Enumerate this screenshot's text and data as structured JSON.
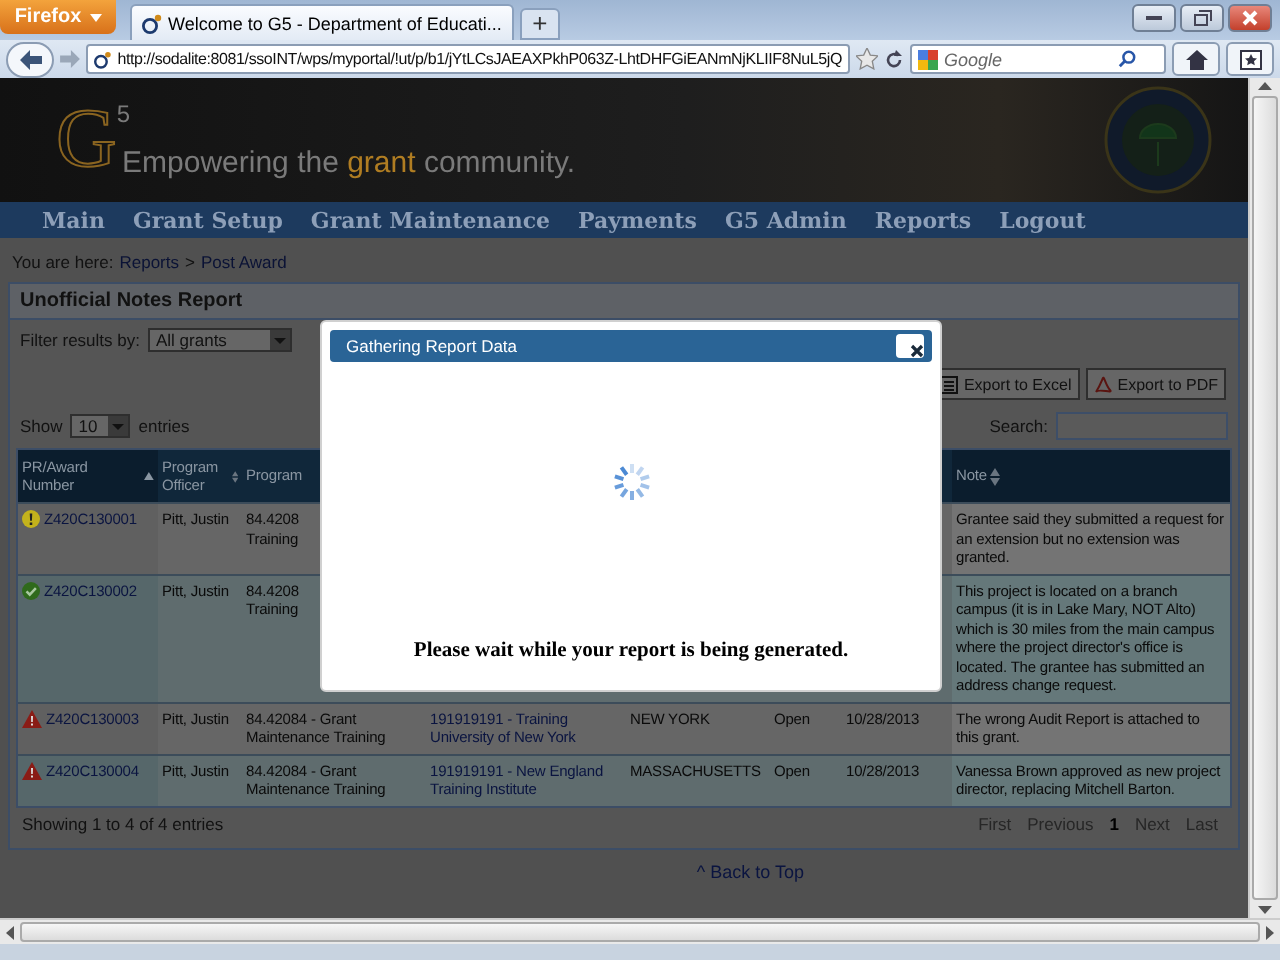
{
  "browser": {
    "menu_button": "Firefox",
    "tab_title": "Welcome to G5 - Department of Educati...",
    "new_tab": "+",
    "url": "http://sodalite:8081/ssoINT/wps/myportal/!ut/p/b1/jYtLCsJAEAXPkhP063Z-LhtDHFGiEANmNjKLIIF8NuL5jQ",
    "search_placeholder": "Google"
  },
  "banner": {
    "logo_letter": "G",
    "logo_sup": "5",
    "tagline": [
      {
        "text": "Empowering the ",
        "highlight": false
      },
      {
        "text": "grant",
        "highlight": true
      },
      {
        "text": " community.",
        "highlight": false
      }
    ]
  },
  "nav": [
    "Main",
    "Grant Setup",
    "Grant Maintenance",
    "Payments",
    "G5 Admin",
    "Reports",
    "Logout"
  ],
  "breadcrumb": {
    "label": "You are here:",
    "links": [
      "Reports",
      "Post Award"
    ],
    "separator": ">"
  },
  "panel": {
    "title": "Unofficial Notes Report",
    "filter_label": "Filter results by:",
    "filter_value": "All grants",
    "exports": [
      {
        "kind": "excel",
        "label": "Export to Excel"
      },
      {
        "kind": "pdf",
        "label": "Export to PDF"
      }
    ],
    "show_label": "Show",
    "show_value": "10",
    "entries_label": "entries",
    "search_label": "Search:"
  },
  "table": {
    "columns": [
      {
        "label": "PR/Award Number",
        "kind": "asc"
      },
      {
        "label": "Program Officer",
        "kind": "both"
      },
      {
        "label": "Program",
        "kind": "none"
      },
      {
        "label": "Note",
        "kind": "both"
      }
    ],
    "rows": [
      {
        "kind": "warning",
        "pr": "Z420C130001",
        "officer": "Pitt, Justin",
        "program": "84.4208\nTraining",
        "note": "Grantee said they submitted a request for an extension but no extension was granted."
      },
      {
        "kind": "ok",
        "pr": "Z420C130002",
        "officer": "Pitt, Justin",
        "program": "84.4208\nTraining",
        "note": "This project is located on a branch campus (it is in Lake Mary, NOT Alto) which is 30 miles from the main campus where the project director's office is located. The grantee has submitted an address change request."
      },
      {
        "kind": "error",
        "pr": "Z420C130003",
        "officer": "Pitt, Justin",
        "program": "84.42084 - Grant Maintenance Training",
        "grantee": "191919191 - Training University of New York",
        "state": "NEW YORK",
        "state_status": "Open",
        "date": "10/28/2013",
        "note": "The wrong Audit Report is attached to this grant."
      },
      {
        "kind": "error",
        "pr": "Z420C130004",
        "officer": "Pitt, Justin",
        "program": "84.42084 - Grant Maintenance Training",
        "grantee": "191919191 - New England Training Institute",
        "state": "MASSACHUSETTS",
        "state_status": "Open",
        "date": "10/28/2013",
        "note": "Vanessa Brown approved as new project director, replacing Mitchell Barton."
      }
    ],
    "info": "Showing 1 to 4 of 4 entries",
    "pages": [
      {
        "label": "First",
        "selected": false
      },
      {
        "label": "Previous",
        "selected": false
      },
      {
        "label": "1",
        "selected": true
      },
      {
        "label": "Next",
        "selected": false
      },
      {
        "label": "Last",
        "selected": false
      }
    ]
  },
  "back_to_top": "^ Back to Top",
  "modal": {
    "title": "Gathering Report Data",
    "message": "Please wait while your report is being generated."
  }
}
